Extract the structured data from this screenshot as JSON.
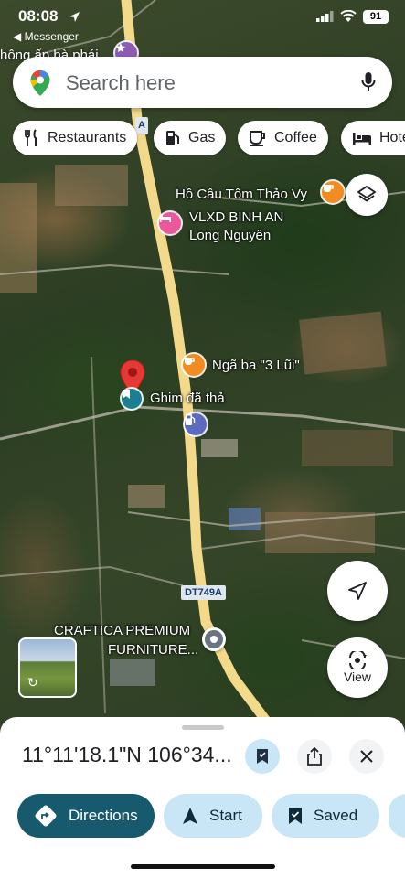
{
  "status_bar": {
    "time": "08:08",
    "back_app": "◀ Messenger",
    "battery": "91"
  },
  "map": {
    "background_place": "hông ấp bà phái",
    "labels": {
      "poi_fishing": "Hồ Câu Tôm Thảo Vy",
      "poi_vlxd": "VLXD BINH AN",
      "poi_long": "Long Nguyên",
      "poi_nga_ba": "Ngã ba \"3 Lũi\"",
      "dropped_pin": "Ghim đã thả",
      "craftica_1": "CRAFTICA PREMIUM",
      "craftica_2": "FURNITURE...",
      "road_shield": "DT749A",
      "road_shield_top": "A"
    },
    "colors": {
      "road": "#f3d98a",
      "pin": "#e53935",
      "poi_orange": "#f28b20",
      "poi_pink": "#e8589b",
      "poi_blue": "#5c6bc0",
      "teal": "#1a7f93"
    }
  },
  "search": {
    "placeholder": "Search here"
  },
  "chips": [
    {
      "label": "Restaurants",
      "icon": "fork-knife-icon"
    },
    {
      "label": "Gas",
      "icon": "gas-pump-icon"
    },
    {
      "label": "Coffee",
      "icon": "coffee-cup-icon"
    },
    {
      "label": "Hotels",
      "icon": "bed-icon"
    }
  ],
  "buttons": {
    "view": "View"
  },
  "sheet": {
    "coordinates": "11°11'18.1\"N 106°34...",
    "actions": {
      "directions": "Directions",
      "start": "Start",
      "saved": "Saved"
    }
  }
}
